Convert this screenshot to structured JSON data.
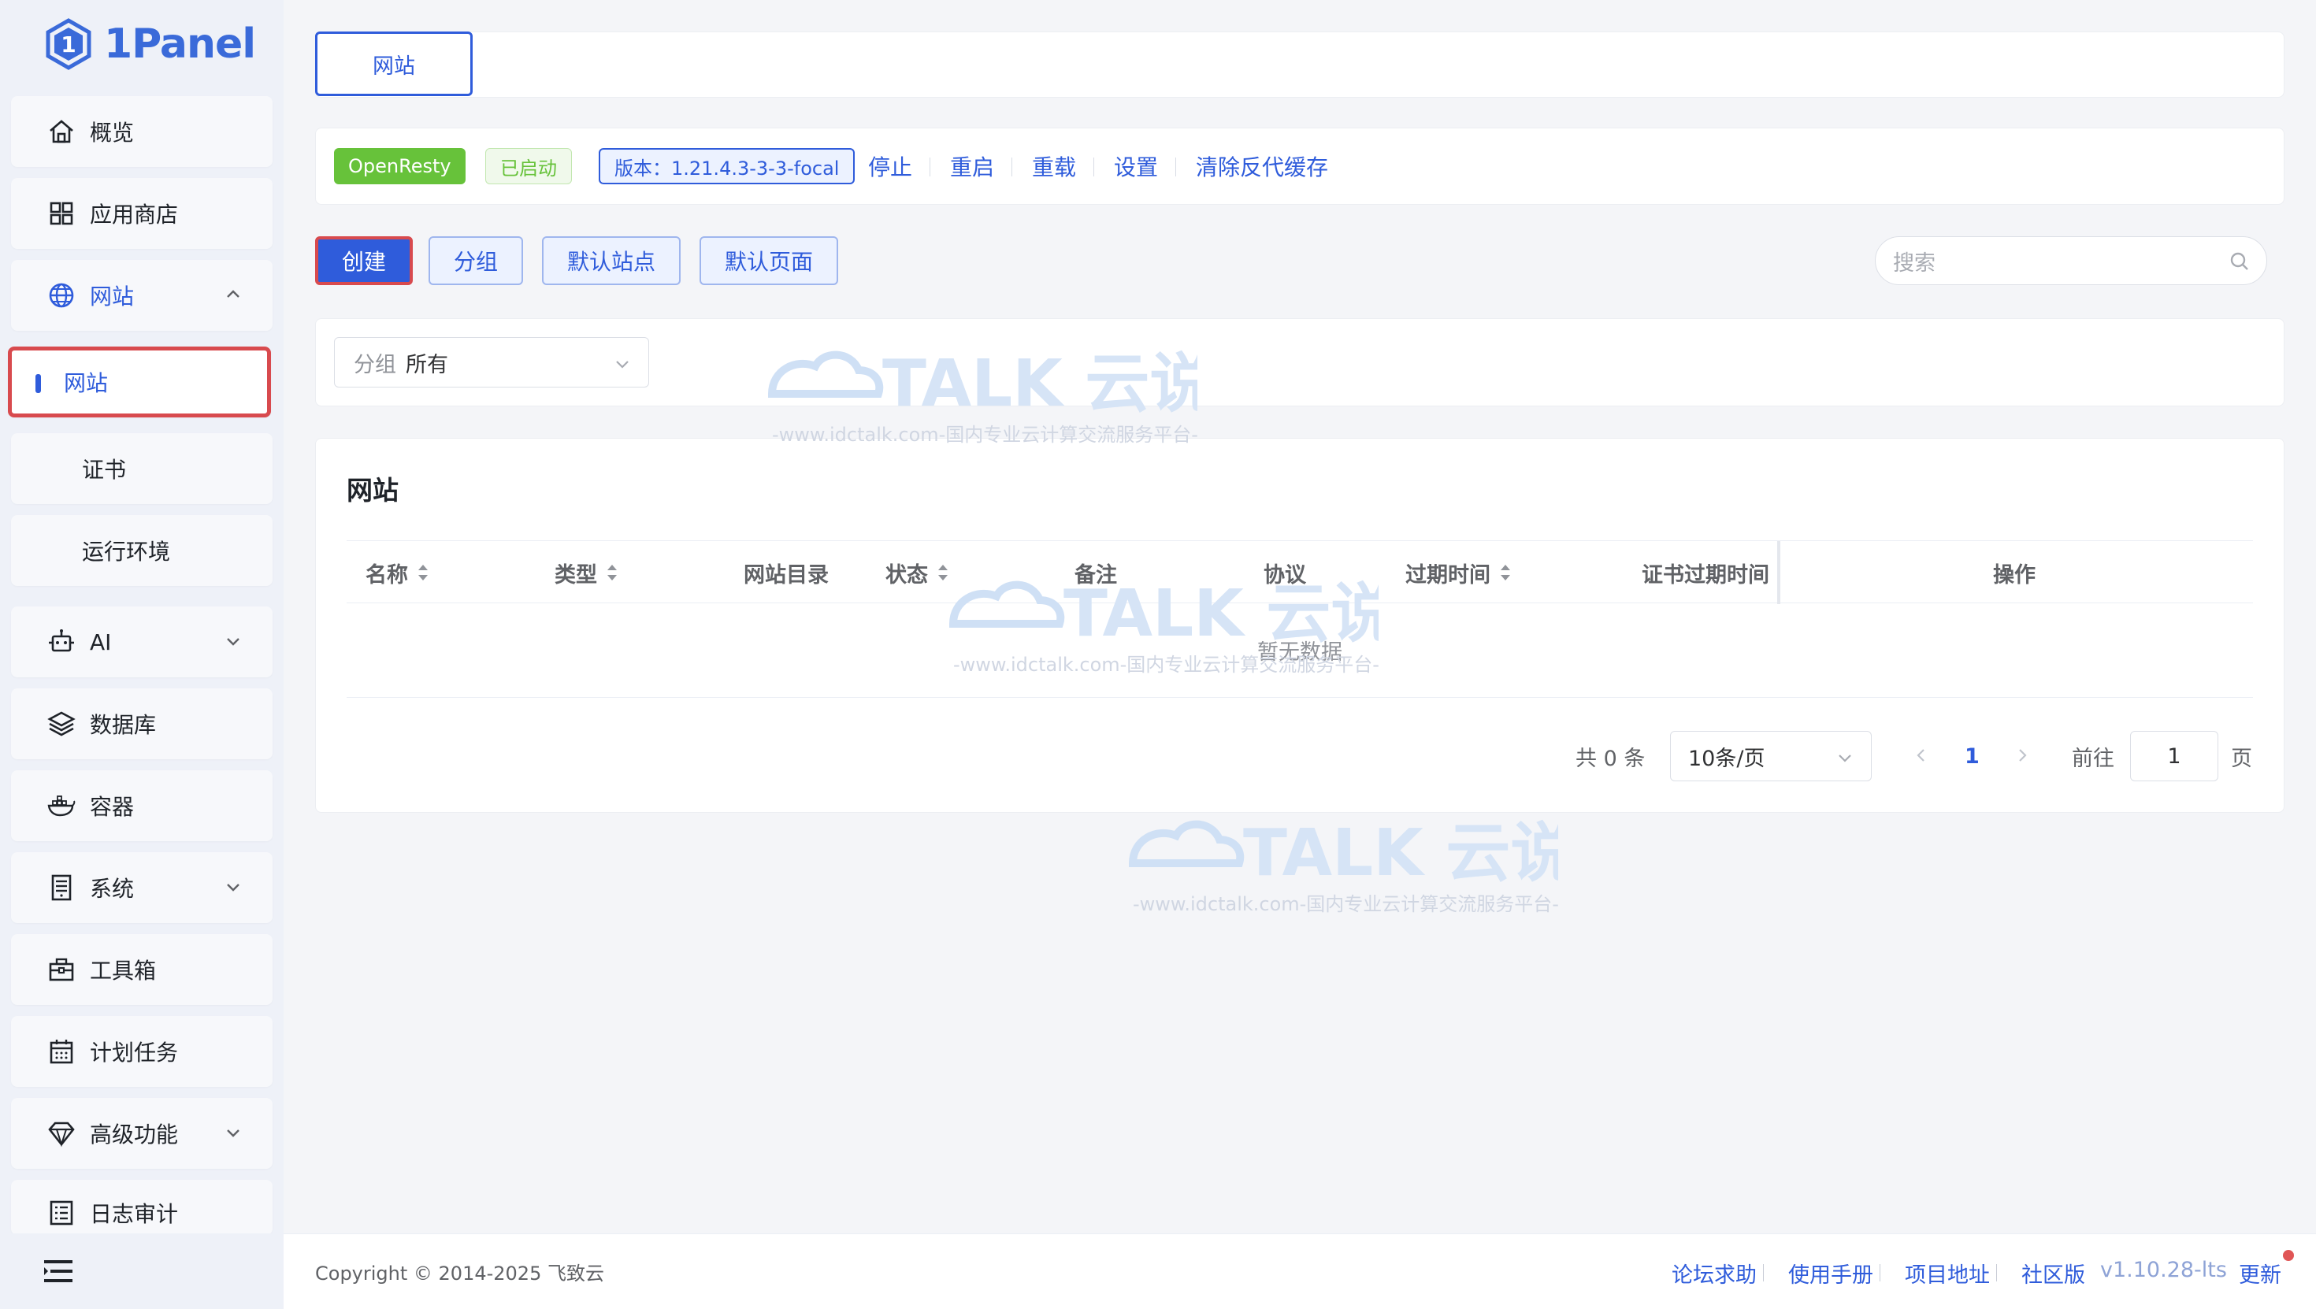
{
  "brand": {
    "name": "1Panel"
  },
  "sidebar": {
    "items": [
      {
        "label": "概览",
        "icon": "home-icon"
      },
      {
        "label": "应用商店",
        "icon": "grid-icon"
      },
      {
        "label": "网站",
        "icon": "globe-icon",
        "expanded": true
      },
      {
        "label": "网站",
        "sub": true,
        "active": true
      },
      {
        "label": "证书",
        "sub": true
      },
      {
        "label": "运行环境",
        "sub": true
      },
      {
        "label": "AI",
        "icon": "robot-icon"
      },
      {
        "label": "数据库",
        "icon": "layers-icon"
      },
      {
        "label": "容器",
        "icon": "docker-icon"
      },
      {
        "label": "系统",
        "icon": "server-icon"
      },
      {
        "label": "工具箱",
        "icon": "toolbox-icon"
      },
      {
        "label": "计划任务",
        "icon": "calendar-icon"
      },
      {
        "label": "高级功能",
        "icon": "diamond-icon"
      },
      {
        "label": "日志审计",
        "icon": "log-icon"
      }
    ]
  },
  "top_tab": {
    "label": "网站"
  },
  "status_bar": {
    "app_tag": "OpenResty",
    "state_tag": "已启动",
    "version_tag": "版本：1.21.4.3-3-3-focal",
    "actions": [
      "停止",
      "重启",
      "重载",
      "设置",
      "清除反代缓存"
    ]
  },
  "toolbar": {
    "create": "创建",
    "group": "分组",
    "default_site": "默认站点",
    "default_page": "默认页面",
    "search_placeholder": "搜索"
  },
  "filter": {
    "prefix": "分组",
    "value": "所有"
  },
  "table": {
    "title": "网站",
    "columns": [
      "名称",
      "类型",
      "网站目录",
      "状态",
      "备注",
      "协议",
      "过期时间",
      "证书过期时间",
      "操作"
    ],
    "empty_text": "暂无数据"
  },
  "pagination": {
    "total_label": "共 0 条",
    "page_size": "10条/页",
    "current_page": "1",
    "goto_label": "前往",
    "goto_value": "1",
    "page_suffix": "页"
  },
  "watermark": {
    "text": "TALK 云说",
    "sub": "-www.idctalk.com-国内专业云计算交流服务平台-"
  },
  "footer": {
    "copyright": "Copyright © 2014-2025 飞致云",
    "links": [
      "论坛求助",
      "使用手册",
      "项目地址",
      "社区版"
    ],
    "version": "v1.10.28-lts",
    "update": "更新"
  },
  "colors": {
    "primary": "#2f5cdb",
    "success": "#67c23a",
    "highlight": "#d84a4e"
  }
}
